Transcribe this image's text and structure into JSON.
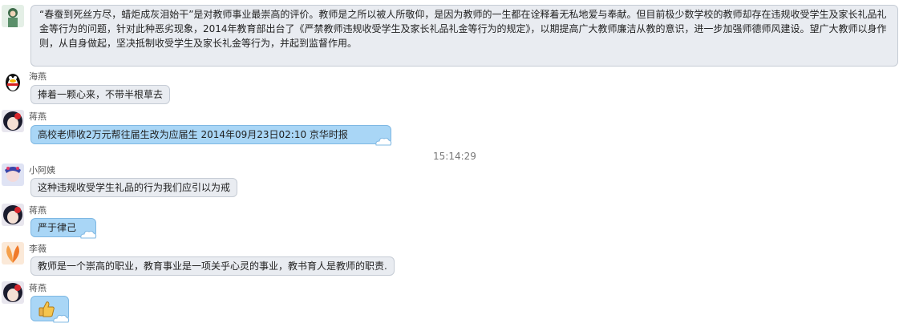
{
  "chat": {
    "messages": [
      {
        "sender": "",
        "text": "“春蚕到死丝方尽，蜡炬成灰泪始干”是对教师事业最崇高的评价。教师是之所以被人所敬仰，是因为教师的一生都在诠释着无私地爱与奉献。但目前极少数学校的教师却存在违规收受学生及家长礼品礼金等行为的问题，针对此种恶劣现象，2014年教育部出台了《严禁教师违规收受学生及家长礼品礼金等行为的规定》，以期提高广大教师廉洁从教的意识，进一步加强师德师风建设。望广大教师以身作则，从自身做起，坚决抵制收受学生及家长礼金等行为，并起到监督作用。"
      },
      {
        "sender": "海燕",
        "text": "捧着一颗心来，不带半根草去"
      },
      {
        "sender": "蒋燕",
        "text": "高校老师收2万元帮往届生改为应届生 2014年09月23日02:10  京华时报"
      },
      {
        "sender": "小阿姨",
        "text": "这种违规收受学生礼品的行为我们应引以为戒"
      },
      {
        "sender": "蒋燕",
        "text": "严于律己"
      },
      {
        "sender": "李薇",
        "text": "教师是一个崇高的职业，教育事业是一项关乎心灵的事业，教书育人是教师的职责."
      },
      {
        "sender": "蒋燕",
        "emoji": "thumbs-up"
      }
    ],
    "timestamp": "15:14:29"
  },
  "colors": {
    "bubble_gray": "#e9ecf1",
    "bubble_blue": "#a9d6f6",
    "accent": "#7fb8e3"
  }
}
